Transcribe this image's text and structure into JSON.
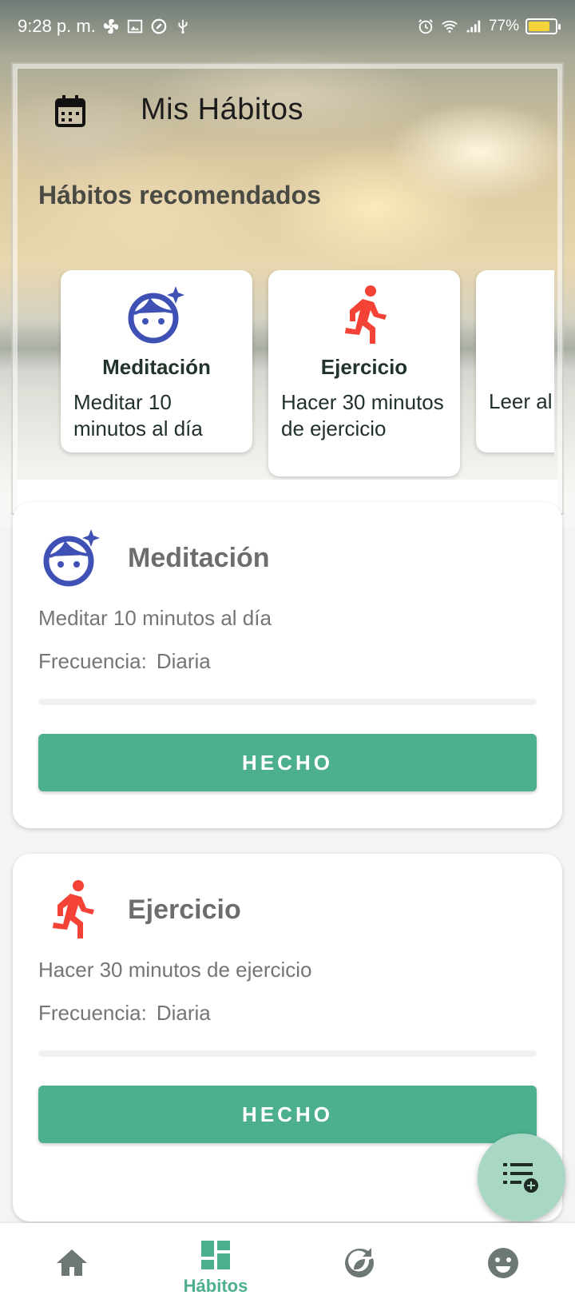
{
  "status_bar": {
    "time": "9:28 p. m.",
    "battery": "77%"
  },
  "header": {
    "title": "Mis Hábitos",
    "icon": "calendar-icon"
  },
  "recommended": {
    "title": "Hábitos recomendados",
    "items": [
      {
        "name": "Meditación",
        "description": "Meditar 10 minutos al día",
        "icon": "face-sparkle-icon"
      },
      {
        "name": "Ejercicio",
        "description": "Hacer 30 minutos de ejercicio",
        "icon": "running-icon"
      },
      {
        "name": "",
        "description": "Leer al día",
        "icon": ""
      }
    ]
  },
  "habits": [
    {
      "title": "Meditación",
      "description": "Meditar 10 minutos al día",
      "frequency_label": "Frecuencia:",
      "frequency_value": "Diaria",
      "progress": 0,
      "button": "HECHO",
      "icon": "face-sparkle-icon"
    },
    {
      "title": "Ejercicio",
      "description": "Hacer 30 minutos de ejercicio",
      "frequency_label": "Frecuencia:",
      "frequency_value": "Diaria",
      "progress": 0,
      "button": "HECHO",
      "icon": "running-icon"
    }
  ],
  "fab": {
    "icon": "add-list-icon"
  },
  "bottom_nav": {
    "items": [
      {
        "label": "",
        "icon": "home-icon"
      },
      {
        "label": "Hábitos",
        "icon": "dashboard-icon",
        "active": true
      },
      {
        "label": "",
        "icon": "sync-leaf-icon"
      },
      {
        "label": "",
        "icon": "smiley-icon"
      }
    ]
  },
  "colors": {
    "accent": "#4caf8f",
    "fab": "#a8d8c4",
    "meditation_icon": "#3f51b5",
    "exercise_icon": "#f44336",
    "nav_inactive": "#6d7872"
  }
}
